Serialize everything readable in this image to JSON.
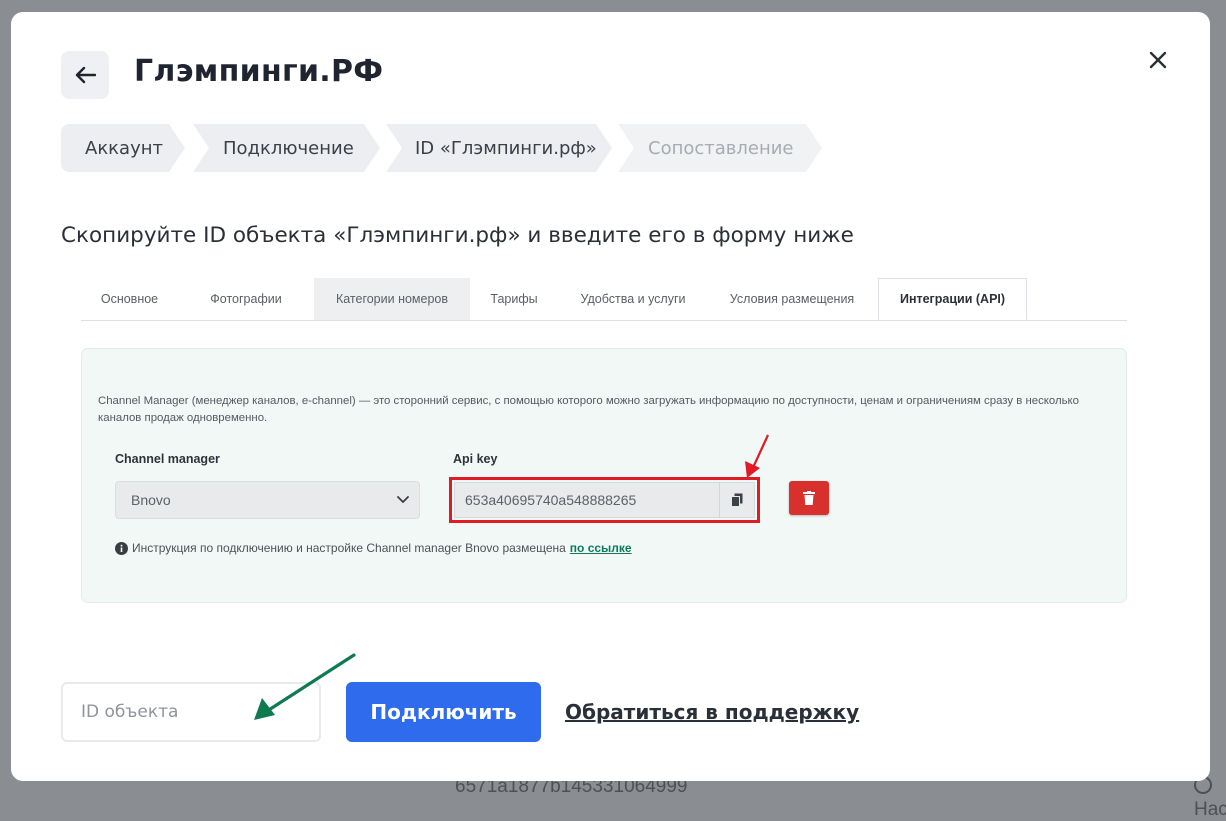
{
  "background": {
    "bottom_text": "6571a1877b145331064999",
    "right_item": "Нас"
  },
  "modal": {
    "title": "Глэмпинги.РФ",
    "steps": [
      {
        "label": "Аккаунт",
        "state": "done"
      },
      {
        "label": "Подключение",
        "state": "done"
      },
      {
        "label": "ID «Глэмпинги.рф»",
        "state": "current"
      },
      {
        "label": "Сопоставление",
        "state": "inactive"
      }
    ],
    "instruction": "Скопируйте ID объекта «Глэмпинги.рф» и введите его в форму ниже",
    "screenshot": {
      "tabs": [
        {
          "label": "Основное"
        },
        {
          "label": "Фотографии"
        },
        {
          "label": "Категории номеров"
        },
        {
          "label": "Тарифы"
        },
        {
          "label": "Удобства и услуги"
        },
        {
          "label": "Условия размещения"
        },
        {
          "label": "Интеграции (API)"
        }
      ],
      "description": "Channel Manager (менеджер каналов, e-channel) — это сторонний сервис, с помощью которого можно загружать информацию по доступности, ценам и ограничениям сразу в несколько каналов продаж одновременно.",
      "channel_manager_label": "Channel manager",
      "channel_manager_value": "Bnovo",
      "api_key_label": "Api key",
      "api_key_value": "653a40695740a548888265",
      "note_text": "Инструкция по подключению и настройке Channel manager Bnovo размещена",
      "note_link": "по ссылке"
    },
    "id_input_placeholder": "ID объекта",
    "connect_label": "Подключить",
    "support_label": "Обратиться в поддержку"
  },
  "colors": {
    "primary": "#2f6bed",
    "highlight_red": "#e01b23",
    "arrow_green": "#0f7a4f",
    "link_green": "#0f7a5a"
  }
}
